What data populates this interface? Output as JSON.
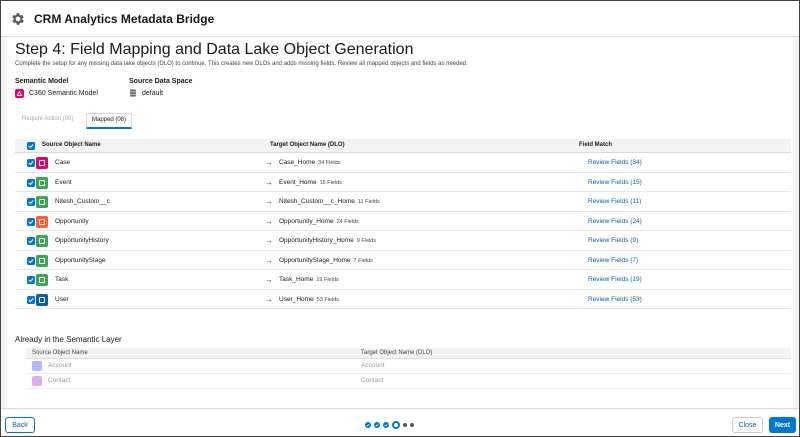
{
  "app": {
    "title": "CRM Analytics Metadata Bridge",
    "icon": "gear-icon"
  },
  "step": {
    "title": "Step 4: Field Mapping and Data Lake Object Generation",
    "description": "Complete the setup for any missing data lake objects (DLO) to continue. This creates new DLOs and adds missing fields. Review all mapped objects and fields as needed."
  },
  "semantic_model": {
    "label": "Semantic Model",
    "value": "C360 Semantic Model",
    "icon": "semantic-model-icon",
    "icon_color": "#e3066a"
  },
  "source_data_space": {
    "label": "Source Data Space",
    "value": "default",
    "icon": "database-icon"
  },
  "tabs": [
    {
      "label": "Require Action (00)",
      "active": false
    },
    {
      "label": "Mapped (08)",
      "active": true
    }
  ],
  "table": {
    "headers": {
      "source": "Source Object Name",
      "target": "Target Object Name (DLO)",
      "match": "Field Match"
    },
    "arrow": "→",
    "rows": [
      {
        "source": "Case",
        "target": "Case_Home",
        "fields": "34 Fields",
        "link": "Review Fields (34)",
        "icon": "case-icon",
        "color": "#e3066a",
        "checked": true
      },
      {
        "source": "Event",
        "target": "Event_Home",
        "fields": "15 Fields",
        "link": "Review Fields (15)",
        "icon": "event-icon",
        "color": "#3ba755",
        "checked": true
      },
      {
        "source": "Nitesh_Custom__c",
        "target": "Nitesh_Custom__c_Home",
        "fields": "11 Fields",
        "link": "Review Fields (11)",
        "icon": "custom-object-icon",
        "color": "#3ba755",
        "checked": true
      },
      {
        "source": "Opportunity",
        "target": "Opportunity_Home",
        "fields": "24 Fields",
        "link": "Review Fields (24)",
        "icon": "opportunity-icon",
        "color": "#ff5d2d",
        "checked": true
      },
      {
        "source": "OpportunityHistory",
        "target": "OpportunityHistory_Home",
        "fields": "9 Fields",
        "link": "Review Fields (9)",
        "icon": "history-icon",
        "color": "#3ba755",
        "checked": true
      },
      {
        "source": "OpportunityStage",
        "target": "OpportunityStage_Home",
        "fields": "7 Fields",
        "link": "Review Fields (7)",
        "icon": "stage-icon",
        "color": "#3ba755",
        "checked": true
      },
      {
        "source": "Task",
        "target": "Task_Home",
        "fields": "19 Fields",
        "link": "Review Fields (19)",
        "icon": "task-icon",
        "color": "#3ba755",
        "checked": true
      },
      {
        "source": "User",
        "target": "User_Home",
        "fields": "53 Fields",
        "link": "Review Fields (53)",
        "icon": "user-icon",
        "color": "#0b5cab",
        "checked": true
      }
    ]
  },
  "semantic_layer": {
    "title": "Already in the Semantic Layer",
    "headers": {
      "source": "Source Object Name",
      "target": "Target Object Name (DLO)"
    },
    "rows": [
      {
        "source": "Account",
        "target": "Account",
        "icon": "account-icon",
        "color": "#5867e8"
      },
      {
        "source": "Contact",
        "target": "Contact",
        "icon": "contact-icon",
        "color": "#a94fd8"
      }
    ]
  },
  "footer": {
    "back_label": "Back",
    "close_label": "Close",
    "next_label": "Next",
    "progress": {
      "total_steps": 6,
      "current_step": 4
    }
  }
}
